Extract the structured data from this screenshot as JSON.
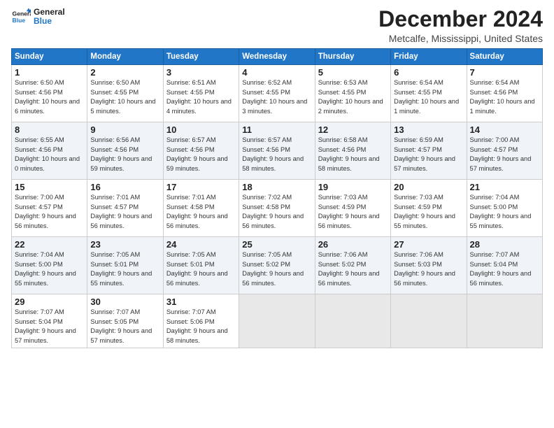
{
  "header": {
    "logo_line1": "General",
    "logo_line2": "Blue",
    "month": "December 2024",
    "location": "Metcalfe, Mississippi, United States"
  },
  "days_of_week": [
    "Sunday",
    "Monday",
    "Tuesday",
    "Wednesday",
    "Thursday",
    "Friday",
    "Saturday"
  ],
  "weeks": [
    [
      {
        "day": "1",
        "sunrise": "6:50 AM",
        "sunset": "4:56 PM",
        "daylight": "10 hours and 6 minutes."
      },
      {
        "day": "2",
        "sunrise": "6:50 AM",
        "sunset": "4:55 PM",
        "daylight": "10 hours and 5 minutes."
      },
      {
        "day": "3",
        "sunrise": "6:51 AM",
        "sunset": "4:55 PM",
        "daylight": "10 hours and 4 minutes."
      },
      {
        "day": "4",
        "sunrise": "6:52 AM",
        "sunset": "4:55 PM",
        "daylight": "10 hours and 3 minutes."
      },
      {
        "day": "5",
        "sunrise": "6:53 AM",
        "sunset": "4:55 PM",
        "daylight": "10 hours and 2 minutes."
      },
      {
        "day": "6",
        "sunrise": "6:54 AM",
        "sunset": "4:55 PM",
        "daylight": "10 hours and 1 minute."
      },
      {
        "day": "7",
        "sunrise": "6:54 AM",
        "sunset": "4:56 PM",
        "daylight": "10 hours and 1 minute."
      }
    ],
    [
      {
        "day": "8",
        "sunrise": "6:55 AM",
        "sunset": "4:56 PM",
        "daylight": "10 hours and 0 minutes."
      },
      {
        "day": "9",
        "sunrise": "6:56 AM",
        "sunset": "4:56 PM",
        "daylight": "9 hours and 59 minutes."
      },
      {
        "day": "10",
        "sunrise": "6:57 AM",
        "sunset": "4:56 PM",
        "daylight": "9 hours and 59 minutes."
      },
      {
        "day": "11",
        "sunrise": "6:57 AM",
        "sunset": "4:56 PM",
        "daylight": "9 hours and 58 minutes."
      },
      {
        "day": "12",
        "sunrise": "6:58 AM",
        "sunset": "4:56 PM",
        "daylight": "9 hours and 58 minutes."
      },
      {
        "day": "13",
        "sunrise": "6:59 AM",
        "sunset": "4:57 PM",
        "daylight": "9 hours and 57 minutes."
      },
      {
        "day": "14",
        "sunrise": "7:00 AM",
        "sunset": "4:57 PM",
        "daylight": "9 hours and 57 minutes."
      }
    ],
    [
      {
        "day": "15",
        "sunrise": "7:00 AM",
        "sunset": "4:57 PM",
        "daylight": "9 hours and 56 minutes."
      },
      {
        "day": "16",
        "sunrise": "7:01 AM",
        "sunset": "4:57 PM",
        "daylight": "9 hours and 56 minutes."
      },
      {
        "day": "17",
        "sunrise": "7:01 AM",
        "sunset": "4:58 PM",
        "daylight": "9 hours and 56 minutes."
      },
      {
        "day": "18",
        "sunrise": "7:02 AM",
        "sunset": "4:58 PM",
        "daylight": "9 hours and 56 minutes."
      },
      {
        "day": "19",
        "sunrise": "7:03 AM",
        "sunset": "4:59 PM",
        "daylight": "9 hours and 56 minutes."
      },
      {
        "day": "20",
        "sunrise": "7:03 AM",
        "sunset": "4:59 PM",
        "daylight": "9 hours and 55 minutes."
      },
      {
        "day": "21",
        "sunrise": "7:04 AM",
        "sunset": "5:00 PM",
        "daylight": "9 hours and 55 minutes."
      }
    ],
    [
      {
        "day": "22",
        "sunrise": "7:04 AM",
        "sunset": "5:00 PM",
        "daylight": "9 hours and 55 minutes."
      },
      {
        "day": "23",
        "sunrise": "7:05 AM",
        "sunset": "5:01 PM",
        "daylight": "9 hours and 55 minutes."
      },
      {
        "day": "24",
        "sunrise": "7:05 AM",
        "sunset": "5:01 PM",
        "daylight": "9 hours and 56 minutes."
      },
      {
        "day": "25",
        "sunrise": "7:05 AM",
        "sunset": "5:02 PM",
        "daylight": "9 hours and 56 minutes."
      },
      {
        "day": "26",
        "sunrise": "7:06 AM",
        "sunset": "5:02 PM",
        "daylight": "9 hours and 56 minutes."
      },
      {
        "day": "27",
        "sunrise": "7:06 AM",
        "sunset": "5:03 PM",
        "daylight": "9 hours and 56 minutes."
      },
      {
        "day": "28",
        "sunrise": "7:07 AM",
        "sunset": "5:04 PM",
        "daylight": "9 hours and 56 minutes."
      }
    ],
    [
      {
        "day": "29",
        "sunrise": "7:07 AM",
        "sunset": "5:04 PM",
        "daylight": "9 hours and 57 minutes."
      },
      {
        "day": "30",
        "sunrise": "7:07 AM",
        "sunset": "5:05 PM",
        "daylight": "9 hours and 57 minutes."
      },
      {
        "day": "31",
        "sunrise": "7:07 AM",
        "sunset": "5:06 PM",
        "daylight": "9 hours and 58 minutes."
      },
      null,
      null,
      null,
      null
    ]
  ]
}
